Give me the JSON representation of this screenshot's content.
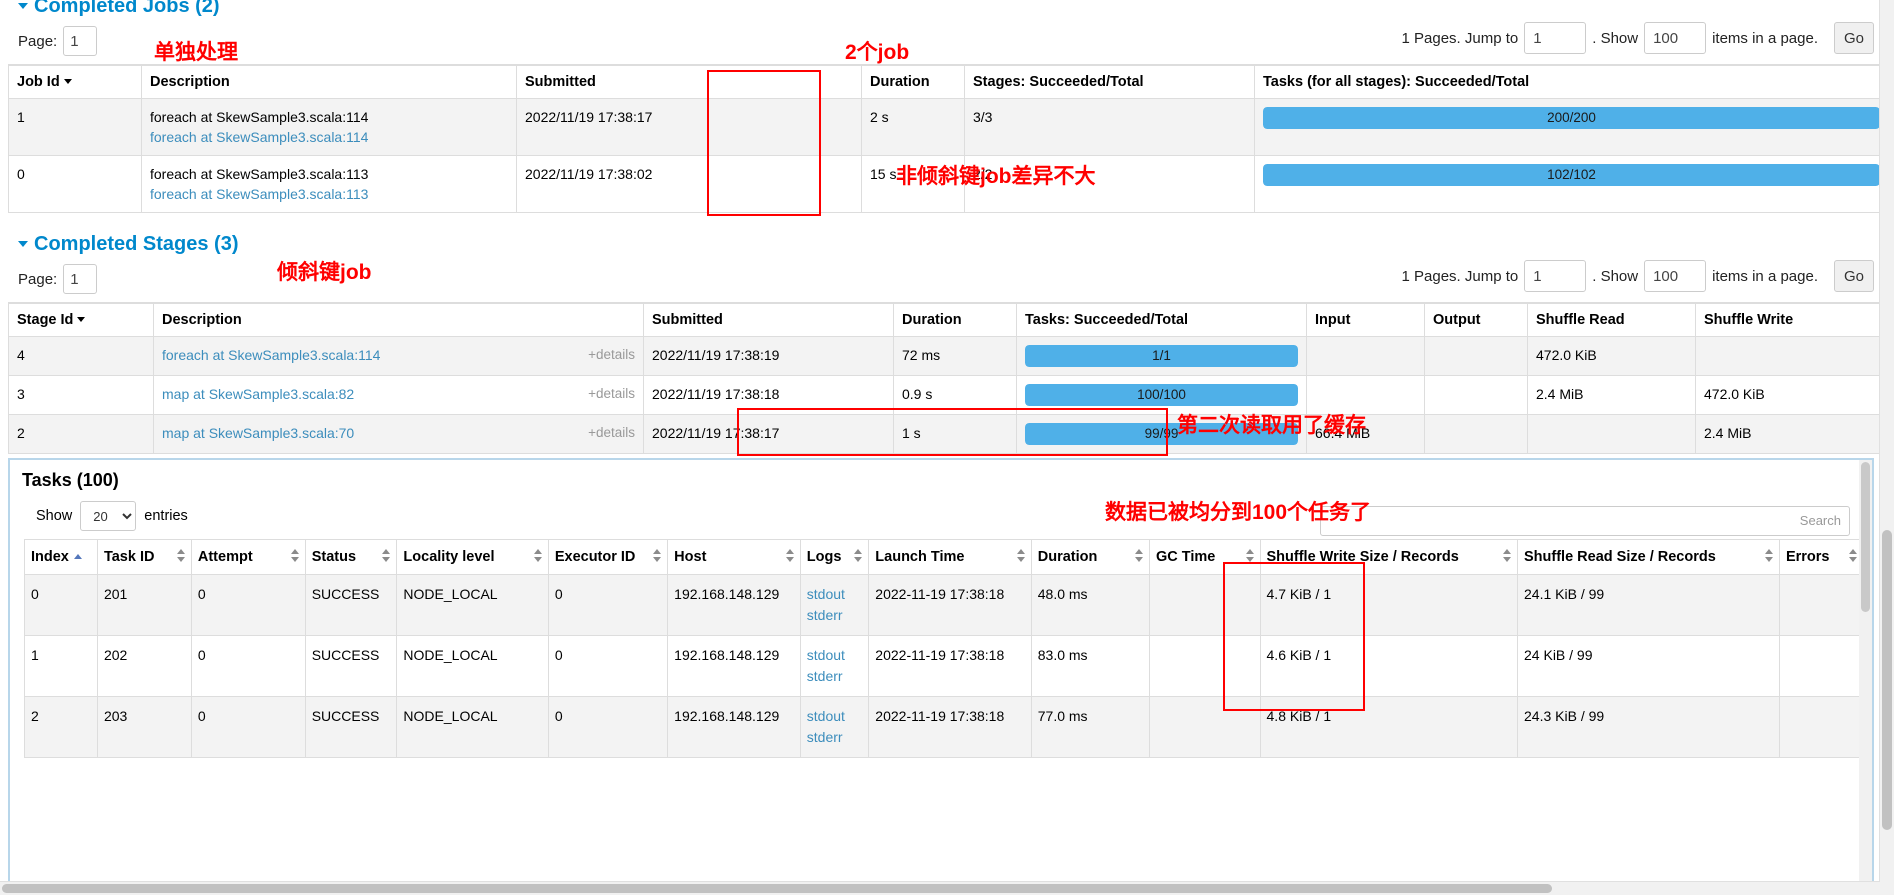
{
  "jobs_section": {
    "title": "Completed Jobs (2)",
    "page_label": "Page:",
    "page_value": "1",
    "pages_text": "1 Pages. Jump to",
    "jump_value": "1",
    "show_text": ". Show",
    "show_value": "100",
    "items_text": "items in a page.",
    "go_label": "Go",
    "columns": [
      "Job Id",
      "Description",
      "Submitted",
      "Duration",
      "Stages: Succeeded/Total",
      "Tasks (for all stages): Succeeded/Total"
    ],
    "rows": [
      {
        "job_id": "1",
        "description": "foreach at SkewSample3.scala:114",
        "description_link": "foreach at SkewSample3.scala:114",
        "submitted": "2022/11/19 17:38:17",
        "duration": "2 s",
        "stages": "3/3",
        "tasks_text": "200/200",
        "tasks_pct": 100
      },
      {
        "job_id": "0",
        "description": "foreach at SkewSample3.scala:113",
        "description_link": "foreach at SkewSample3.scala:113",
        "submitted": "2022/11/19 17:38:02",
        "duration": "15 s",
        "stages": "2/2",
        "tasks_text": "102/102",
        "tasks_pct": 100
      }
    ]
  },
  "stages_section": {
    "title": "Completed Stages (3)",
    "page_label": "Page:",
    "page_value": "1",
    "pages_text": "1 Pages. Jump to",
    "jump_value": "1",
    "show_text": ". Show",
    "show_value": "100",
    "items_text": "items in a page.",
    "go_label": "Go",
    "columns": [
      "Stage Id",
      "Description",
      "Submitted",
      "Duration",
      "Tasks: Succeeded/Total",
      "Input",
      "Output",
      "Shuffle Read",
      "Shuffle Write"
    ],
    "details_label": "+details",
    "rows": [
      {
        "stage_id": "4",
        "description": "foreach at SkewSample3.scala:114",
        "submitted": "2022/11/19 17:38:19",
        "duration": "72 ms",
        "tasks_text": "1/1",
        "tasks_pct": 100,
        "input": "",
        "output": "",
        "shuffle_read": "472.0 KiB",
        "shuffle_write": ""
      },
      {
        "stage_id": "3",
        "description": "map at SkewSample3.scala:82",
        "submitted": "2022/11/19 17:38:18",
        "duration": "0.9 s",
        "tasks_text": "100/100",
        "tasks_pct": 100,
        "input": "",
        "output": "",
        "shuffle_read": "2.4 MiB",
        "shuffle_write": "472.0 KiB"
      },
      {
        "stage_id": "2",
        "description": "map at SkewSample3.scala:70",
        "submitted": "2022/11/19 17:38:17",
        "duration": "1 s",
        "tasks_text": "99/99",
        "tasks_pct": 100,
        "input": "66.4 MiB",
        "output": "",
        "shuffle_read": "",
        "shuffle_write": "2.4 MiB"
      }
    ]
  },
  "tasks_section": {
    "title": "Tasks (100)",
    "show_label": "Show",
    "entries_value": "20",
    "entries_label": "entries",
    "search_placeholder": "Search",
    "columns": [
      "Index",
      "Task ID",
      "Attempt",
      "Status",
      "Locality level",
      "Executor ID",
      "Host",
      "Logs",
      "Launch Time",
      "Duration",
      "GC Time",
      "Shuffle Write Size / Records",
      "Shuffle Read Size / Records",
      "Errors"
    ],
    "rows": [
      {
        "index": "0",
        "task_id": "201",
        "attempt": "0",
        "status": "SUCCESS",
        "locality": "NODE_LOCAL",
        "executor_id": "0",
        "host": "192.168.148.129",
        "log_stdout": "stdout",
        "log_stderr": "stderr",
        "launch_time": "2022-11-19 17:38:18",
        "duration": "48.0 ms",
        "gc_time": "",
        "shuffle_write": "4.7 KiB / 1",
        "shuffle_read": "24.1 KiB / 99",
        "errors": ""
      },
      {
        "index": "1",
        "task_id": "202",
        "attempt": "0",
        "status": "SUCCESS",
        "locality": "NODE_LOCAL",
        "executor_id": "0",
        "host": "192.168.148.129",
        "log_stdout": "stdout",
        "log_stderr": "stderr",
        "launch_time": "2022-11-19 17:38:18",
        "duration": "83.0 ms",
        "gc_time": "",
        "shuffle_write": "4.6 KiB / 1",
        "shuffle_read": "24 KiB / 99",
        "errors": ""
      },
      {
        "index": "2",
        "task_id": "203",
        "attempt": "0",
        "status": "SUCCESS",
        "locality": "NODE_LOCAL",
        "executor_id": "0",
        "host": "192.168.148.129",
        "log_stdout": "stdout",
        "log_stderr": "stderr",
        "launch_time": "2022-11-19 17:38:18",
        "duration": "77.0 ms",
        "gc_time": "",
        "shuffle_write": "4.8 KiB / 1",
        "shuffle_read": "24.3 KiB / 99",
        "errors": ""
      }
    ]
  },
  "annotations": {
    "a1": "单独处理",
    "a2": "2个job",
    "a3": "非倾斜键job差异不大",
    "a4": "倾斜键job",
    "a5": "第二次读取用了缓存",
    "a6": "数据已被均分到100个任务了"
  },
  "colors": {
    "accent": "#0088cc",
    "link": "#3c8dbc",
    "progress": "#4fb0e8",
    "annotation": "#ff0000"
  }
}
